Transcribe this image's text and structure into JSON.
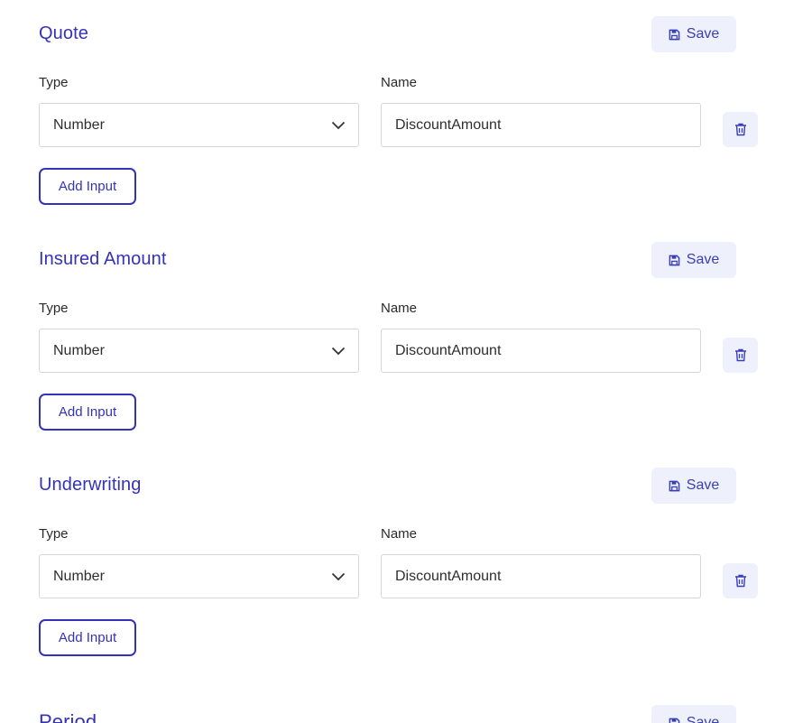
{
  "sections": [
    {
      "title": "Quote",
      "save_label": "Save",
      "type_label": "Type",
      "name_label": "Name",
      "type_value": "Number",
      "name_value": "DiscountAmount",
      "add_input_label": "Add Input"
    },
    {
      "title": "Insured Amount",
      "save_label": "Save",
      "type_label": "Type",
      "name_label": "Name",
      "type_value": "Number",
      "name_value": "DiscountAmount",
      "add_input_label": "Add Input"
    },
    {
      "title": "Underwriting",
      "save_label": "Save",
      "type_label": "Type",
      "name_label": "Name",
      "type_value": "Number",
      "name_value": "DiscountAmount",
      "add_input_label": "Add Input"
    },
    {
      "title": "Period",
      "save_label": "Save"
    }
  ],
  "icons": {
    "save": "save-icon",
    "dropdown": "chevron-down-icon",
    "delete": "trash-icon"
  },
  "colors": {
    "accent": "#3432b8",
    "button_bg": "#eef0fb",
    "border": "#d3d6de",
    "text": "#2e2e2e"
  }
}
